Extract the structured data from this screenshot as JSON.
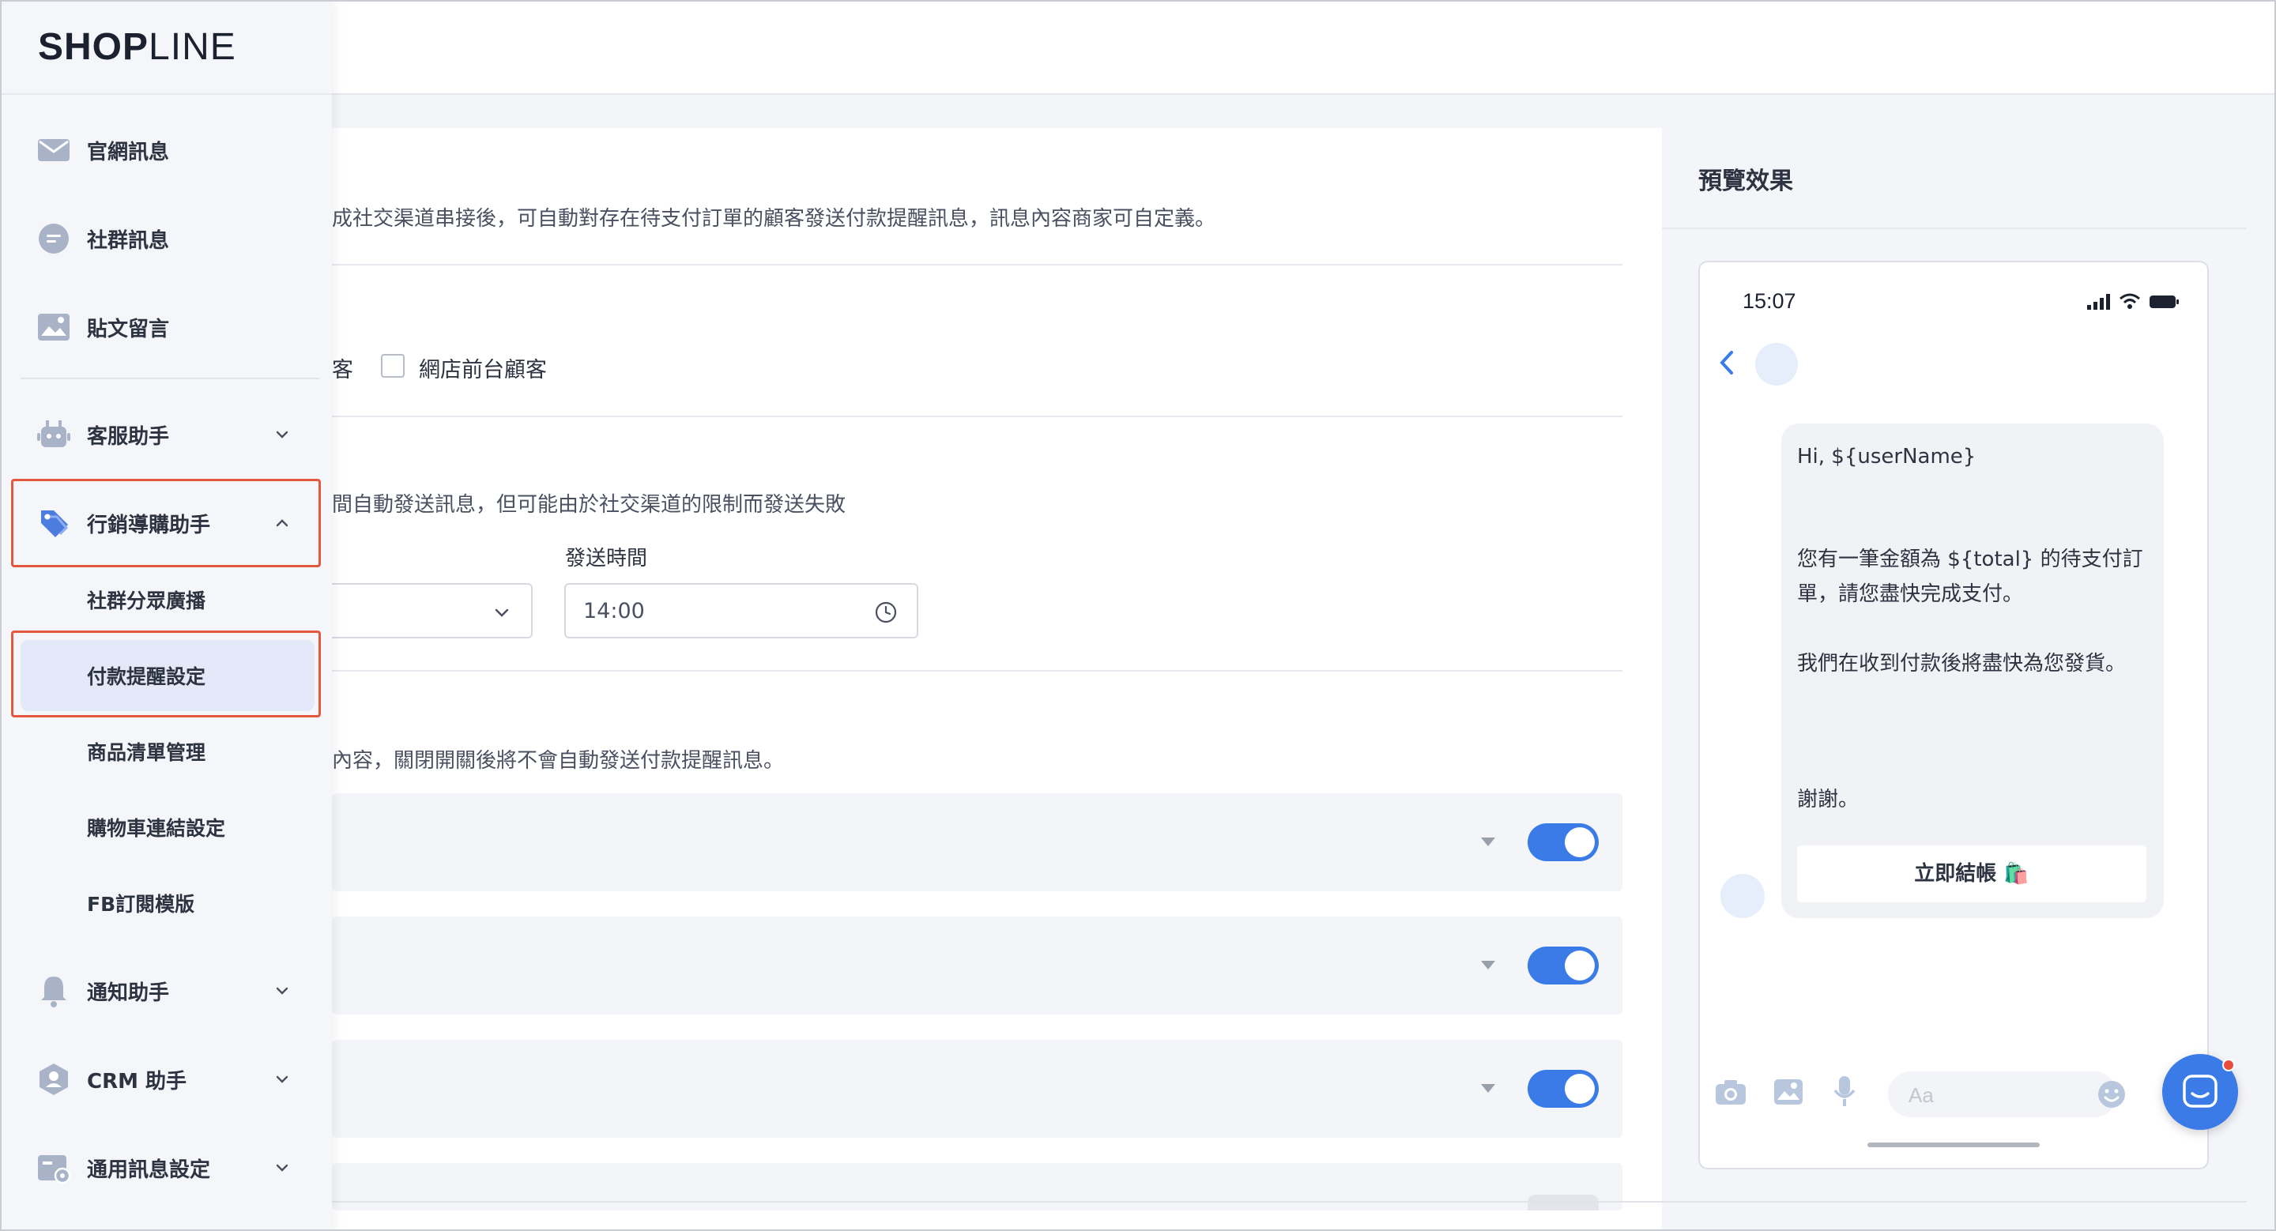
{
  "brand": {
    "logo_bold": "SHOP",
    "logo_light": "LINE",
    "logo_o": "O"
  },
  "sidebar": {
    "items": [
      {
        "label": "官網訊息",
        "icon": "mail-icon"
      },
      {
        "label": "社群訊息",
        "icon": "chat-bubble-icon"
      },
      {
        "label": "貼文留言",
        "icon": "image-post-icon"
      },
      {
        "label": "客服助手",
        "icon": "robot-icon"
      },
      {
        "label": "行銷導購助手",
        "icon": "tag-icon"
      },
      {
        "label": "通知助手",
        "icon": "bell-icon"
      },
      {
        "label": "CRM 助手",
        "icon": "user-badge-icon"
      },
      {
        "label": "通用訊息設定",
        "icon": "settings-card-icon"
      }
    ],
    "sub_items": [
      {
        "label": "社群分眾廣播"
      },
      {
        "label": "付款提醒設定",
        "active": true
      },
      {
        "label": "商品清單管理"
      },
      {
        "label": "購物車連結設定"
      },
      {
        "label": "FB訂閱模版"
      }
    ]
  },
  "main": {
    "intro_text": "成社交渠道串接後，可自動對存在待支付訂單的顧客發送付款提醒訊息，訊息內容商家可自定義。",
    "audience_partial": "客",
    "audience_option": "網店前台顧客",
    "schedule_desc": "間自動發送訊息，但可能由於社交渠道的限制而發送失敗",
    "send_time_label": "發送時間",
    "send_time_value": "14:00",
    "toggle_desc": "內容，關閉開關後將不會自動發送付款提醒訊息。",
    "toggles": [
      true,
      true,
      true
    ]
  },
  "preview": {
    "title": "預覽效果",
    "status_time": "15:07",
    "greeting": "Hi, ${userName}",
    "line1": "您有一筆金額為 ${total} 的待支付訂單，請您盡快完成支付。",
    "line2": "我們在收到付款後將盡快為您發貨。",
    "line3": "謝謝。",
    "checkout_button": "立即結帳 🛍️",
    "input_placeholder": "Aa"
  },
  "colors": {
    "accent": "#3b7be8",
    "highlight_box": "#e2573e",
    "active_bg": "#e3e9f8"
  }
}
